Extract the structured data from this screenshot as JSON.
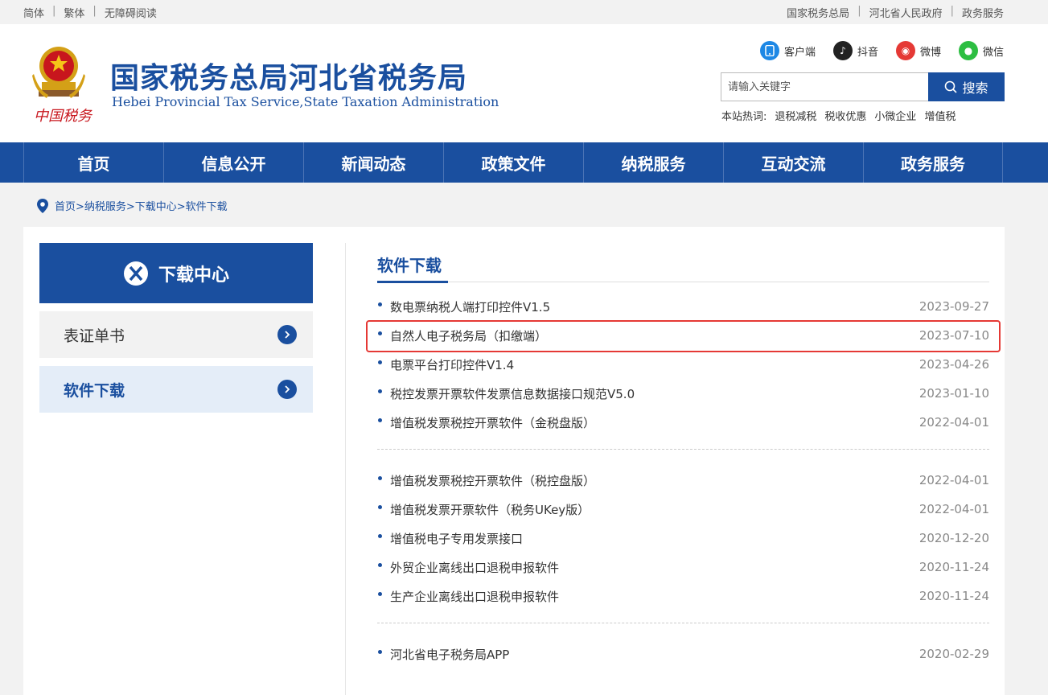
{
  "topbar": {
    "left": [
      "简体",
      "繁体",
      "无障碍阅读"
    ],
    "right": [
      "国家税务总局",
      "河北省人民政府",
      "政务服务"
    ]
  },
  "header": {
    "emblem_text": "中国税务",
    "title": "国家税务总局河北省税务局",
    "subtitle": "Hebei Provincial Tax Service,State Taxation Administration"
  },
  "socials": [
    {
      "label": "客户端",
      "icon": "mobile-client-icon",
      "color": "#1e88e5"
    },
    {
      "label": "抖音",
      "icon": "douyin-icon",
      "color": "#222222"
    },
    {
      "label": "微博",
      "icon": "weibo-icon",
      "color": "#e53935"
    },
    {
      "label": "微信",
      "icon": "wechat-icon",
      "color": "#2dbe42"
    }
  ],
  "search": {
    "placeholder": "请输入关键字",
    "button": "搜索",
    "hot_label": "本站热词:",
    "hot_words": [
      "退税减税",
      "税收优惠",
      "小微企业",
      "增值税"
    ]
  },
  "nav": [
    "首页",
    "信息公开",
    "新闻动态",
    "政策文件",
    "纳税服务",
    "互动交流",
    "政务服务"
  ],
  "breadcrumb": "首页>纳税服务>下载中心>软件下载",
  "sidebar": {
    "title": "下载中心",
    "items": [
      {
        "label": "表证单书",
        "active": false
      },
      {
        "label": "软件下载",
        "active": true
      }
    ]
  },
  "section_title": "软件下载",
  "groups": [
    [
      {
        "title": "数电票纳税人端打印控件V1.5",
        "date": "2023-09-27"
      },
      {
        "title": "自然人电子税务局（扣缴端）",
        "date": "2023-07-10"
      },
      {
        "title": "电票平台打印控件V1.4",
        "date": "2023-04-26"
      },
      {
        "title": "税控发票开票软件发票信息数据接口规范V5.0",
        "date": "2023-01-10"
      },
      {
        "title": "增值税发票税控开票软件（金税盘版）",
        "date": "2022-04-01"
      }
    ],
    [
      {
        "title": "增值税发票税控开票软件（税控盘版）",
        "date": "2022-04-01"
      },
      {
        "title": "增值税发票开票软件（税务UKey版）",
        "date": "2022-04-01"
      },
      {
        "title": "增值税电子专用发票接口",
        "date": "2020-12-20"
      },
      {
        "title": "外贸企业离线出口退税申报软件",
        "date": "2020-11-24"
      },
      {
        "title": "生产企业离线出口退税申报软件",
        "date": "2020-11-24"
      }
    ],
    [
      {
        "title": "河北省电子税务局APP",
        "date": "2020-02-29"
      }
    ]
  ]
}
